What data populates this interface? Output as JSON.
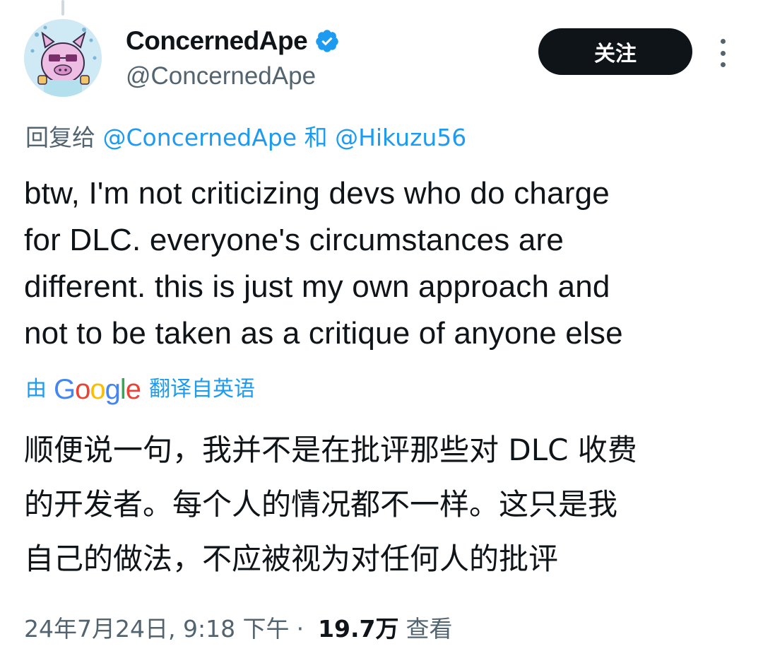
{
  "author": {
    "display_name": "ConcernedApe",
    "handle": "@ConcernedApe",
    "verified": true,
    "verified_color": "#1d9bf0"
  },
  "header": {
    "follow_label": "关注",
    "more_icon": "more-vertical-icon"
  },
  "reply": {
    "prefix": "回复给",
    "mention_1": "@ConcernedApe",
    "conjunction": "和",
    "mention_2": "@Hikuzu56"
  },
  "tweet": {
    "text": "btw, I'm not criticizing devs who do charge\nfor DLC. everyone's circumstances are\ndifferent. this is just my own approach and\nnot to be taken as a critique of anyone else"
  },
  "translation": {
    "by_label": "由",
    "provider": "Google",
    "suffix": "翻译自英语",
    "text": "顺便说一句，我并不是在批评那些对 DLC 收费\n的开发者。每个人的情况都不一样。这只是我\n自己的做法，不应被视为对任何人的批评"
  },
  "meta": {
    "timestamp": "24年7月24日, 9:18 下午",
    "separator": "·",
    "views_count": "19.7万",
    "views_label": "查看"
  },
  "colors": {
    "text": "#0f1419",
    "secondary": "#536471",
    "link": "#1d9bf0"
  }
}
